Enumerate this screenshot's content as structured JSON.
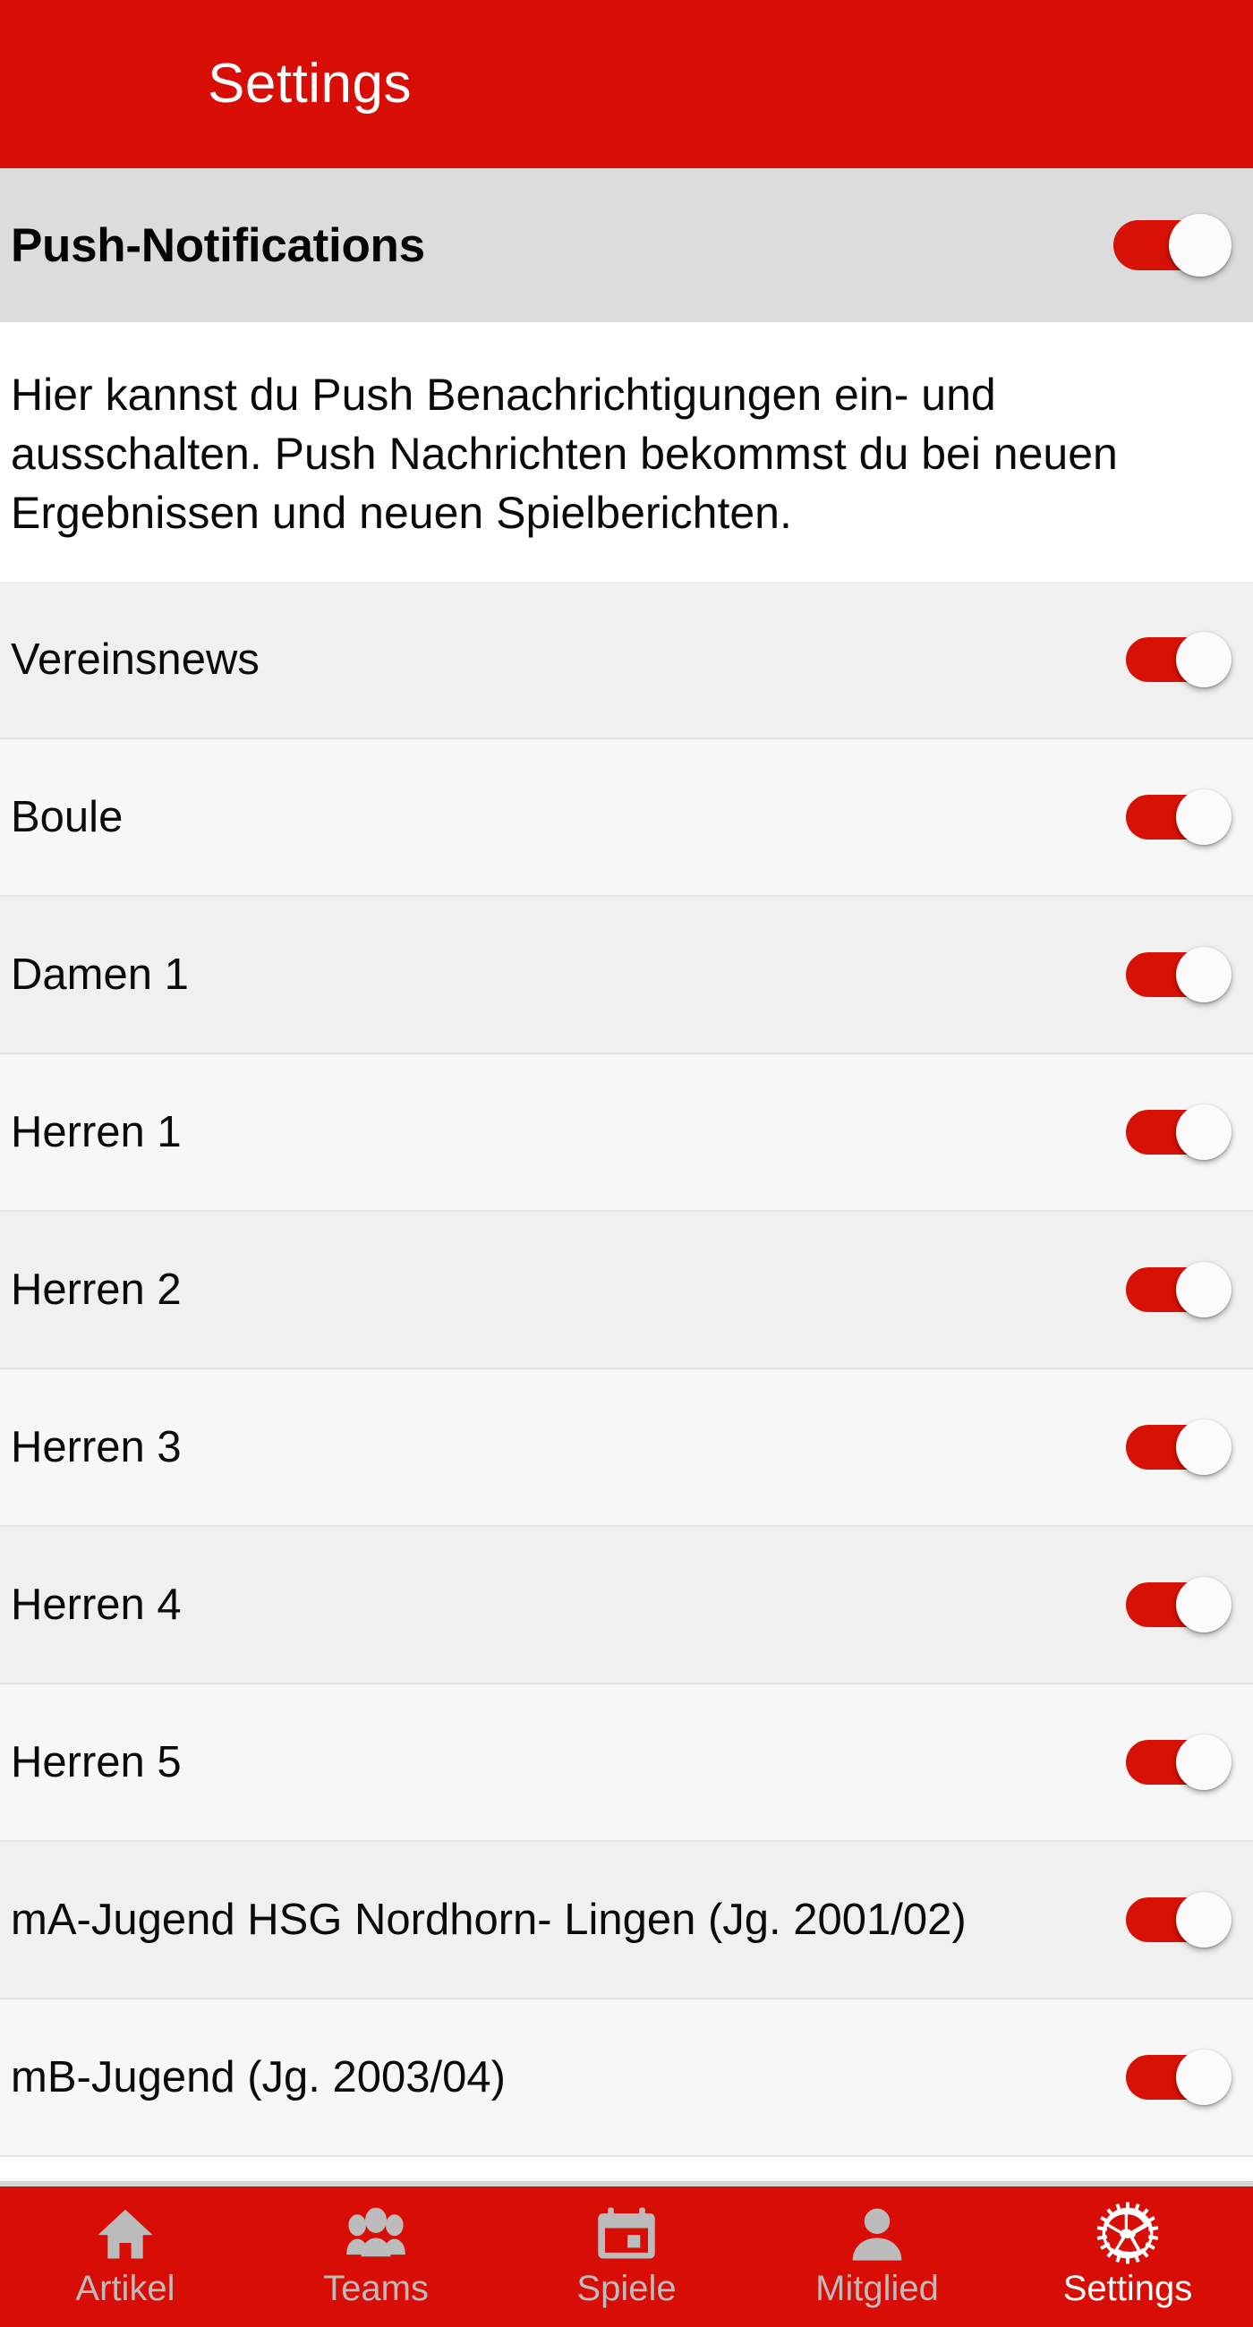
{
  "header": {
    "title": "Settings",
    "bg_color": "#d80d06",
    "text_color": "#ffffff"
  },
  "section": {
    "label": "Push-Notifications",
    "toggle_on": true,
    "bg_color": "#dcdcdc"
  },
  "description": {
    "text": "Hier kannst du Push Benachrichtigungen ein- und ausschalten. Push Nachrichten bekommst du bei neuen Ergebnissen und neuen Spielberichten."
  },
  "list": {
    "rows": [
      {
        "label": "Vereinsnews",
        "toggle_on": true
      },
      {
        "label": "Boule",
        "toggle_on": true
      },
      {
        "label": "Damen 1",
        "toggle_on": true
      },
      {
        "label": "Herren 1",
        "toggle_on": true
      },
      {
        "label": "Herren 2",
        "toggle_on": true
      },
      {
        "label": "Herren 3",
        "toggle_on": true
      },
      {
        "label": "Herren 4",
        "toggle_on": true
      },
      {
        "label": "Herren 5",
        "toggle_on": true
      },
      {
        "label": "mA-Jugend HSG Nordhorn- Lingen (Jg. 2001/02)",
        "toggle_on": true
      },
      {
        "label": "mB-Jugend (Jg. 2003/04)",
        "toggle_on": true
      }
    ]
  },
  "bottom_nav": {
    "bg_color": "#d80d06",
    "inactive_color": "#bcbcbc",
    "active_color": "#ffffff",
    "items": [
      {
        "label": "Artikel",
        "icon": "home-icon",
        "active": false
      },
      {
        "label": "Teams",
        "icon": "people-group-icon",
        "active": false
      },
      {
        "label": "Spiele",
        "icon": "calendar-icon",
        "active": false
      },
      {
        "label": "Mitglied",
        "icon": "person-icon",
        "active": false
      },
      {
        "label": "Settings",
        "icon": "gear-icon",
        "active": true
      }
    ]
  },
  "colors": {
    "accent_red": "#d80d06",
    "toggle_on_track": "#d81106",
    "toggle_thumb": "#fbfbfb",
    "row_even": "#f0f0f0",
    "row_odd": "#f7f7f7",
    "section_bg": "#dcdcdc"
  }
}
